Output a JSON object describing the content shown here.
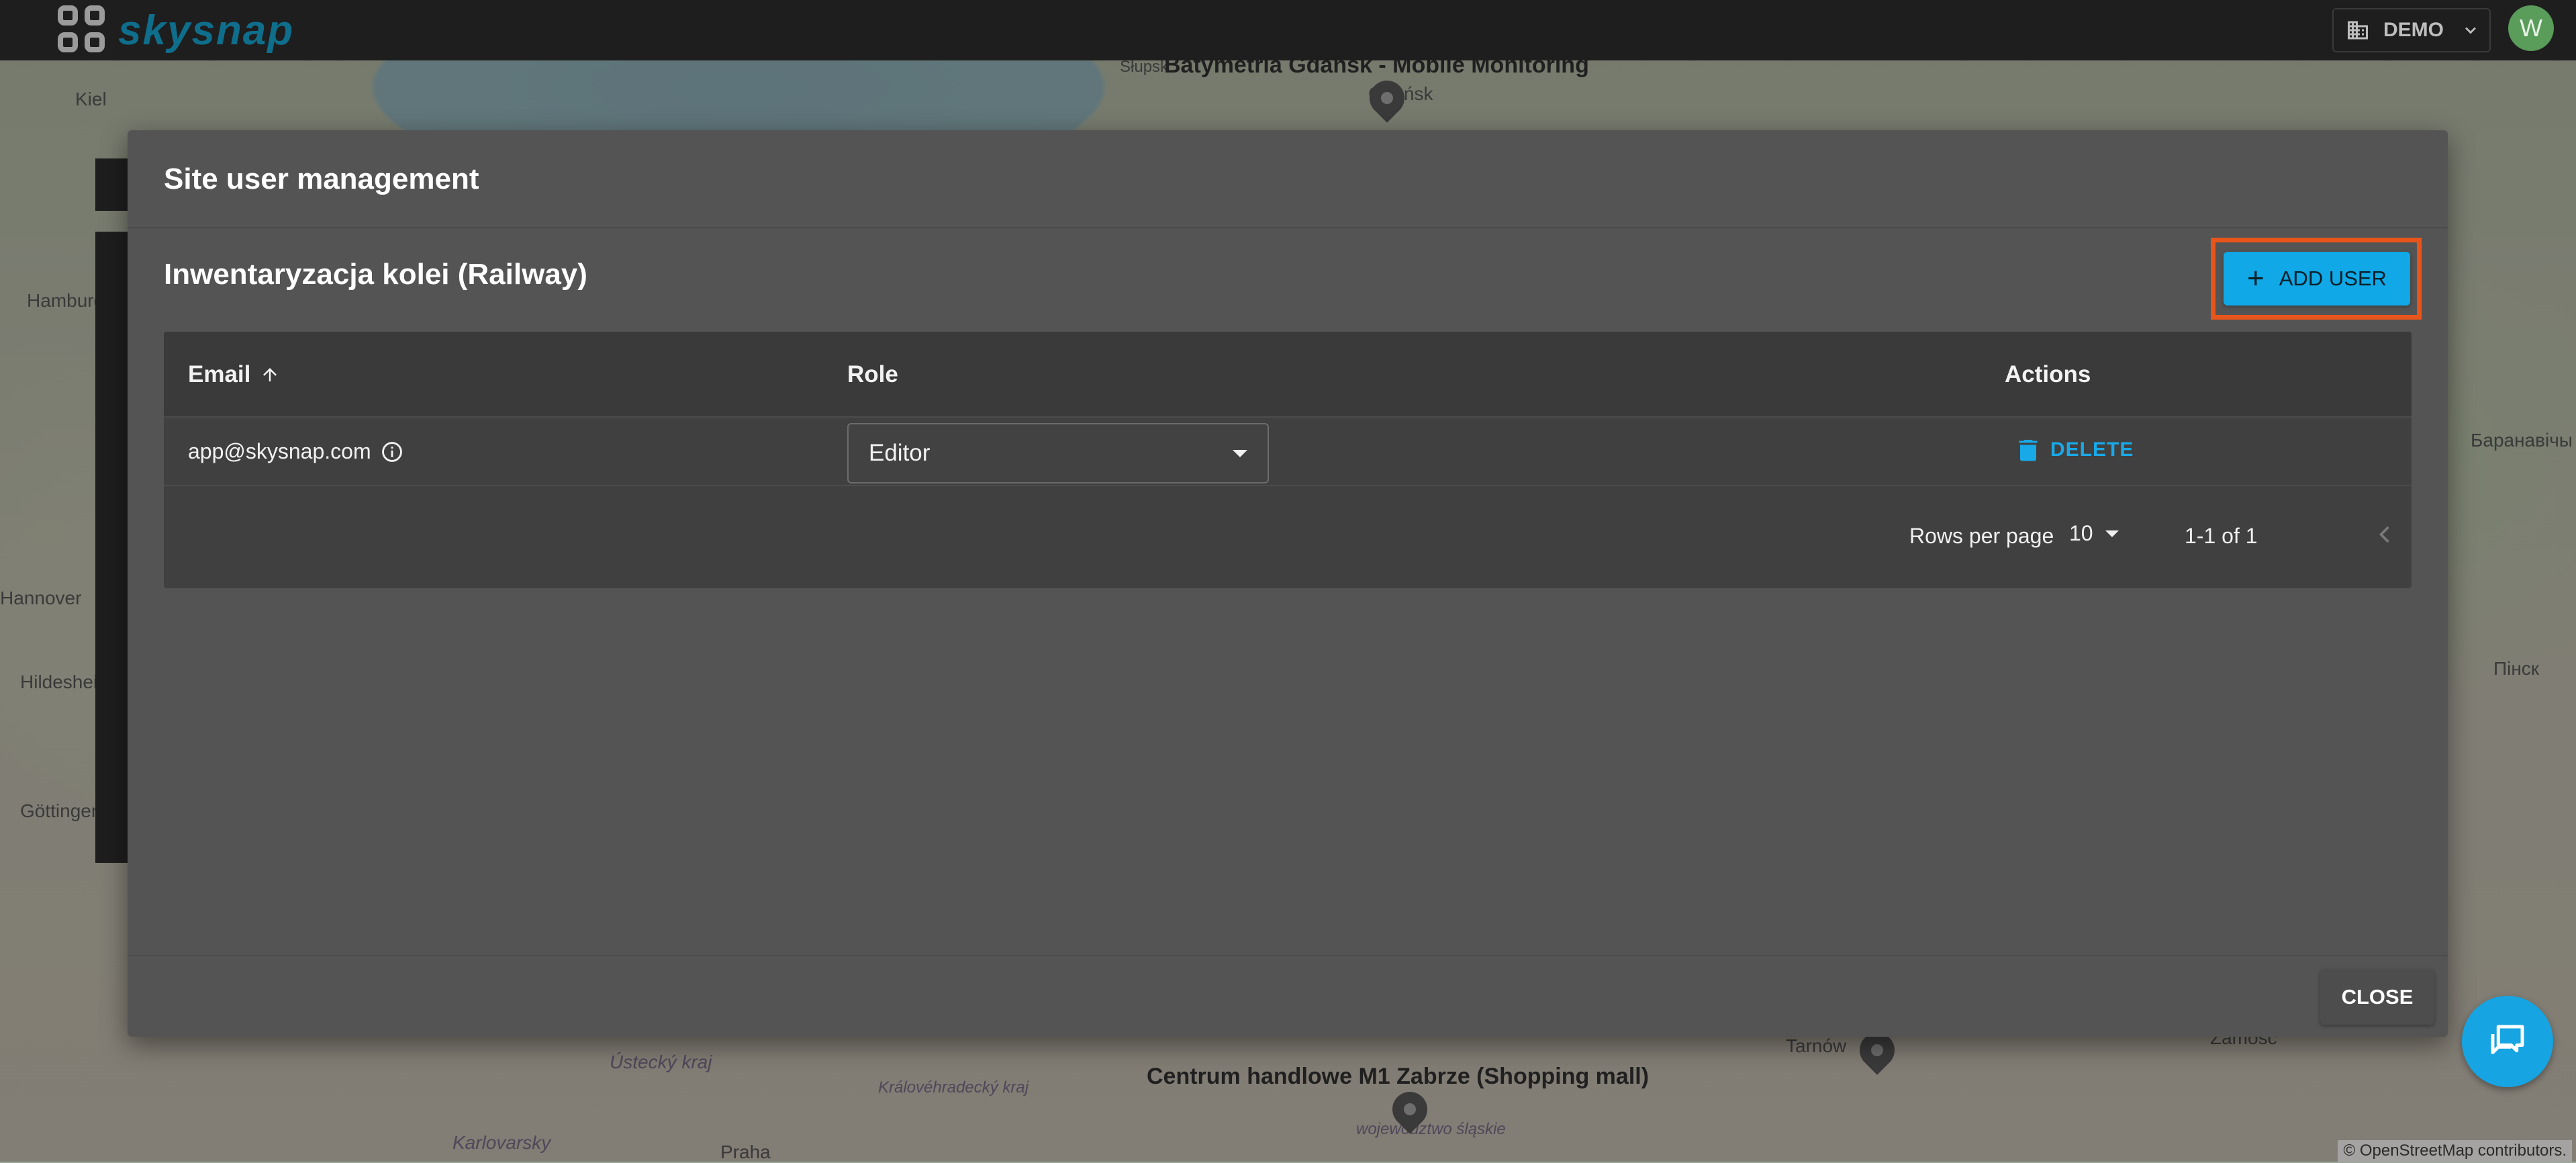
{
  "app": {
    "logo_text": "skysnap"
  },
  "topbar": {
    "org": "DEMO",
    "avatar_initial": "W"
  },
  "map": {
    "cities": [
      "Kiel",
      "Hamburg",
      "Hannover",
      "Hildesheim",
      "Göttingen",
      "Słupsk",
      "Gdańsk",
      "Praha",
      "Karlovarsky",
      "Ústecký kraj",
      "Královéhradecký kraj",
      "województwo śląskie",
      "Tarnów",
      "Zamość",
      "Баранавічы",
      "Пінск"
    ],
    "sites": [
      "Batymetria Gdańsk - Mobile Monitoring",
      "Centrum handlowe M1 Zabrze (Shopping mall)"
    ],
    "attribution": "© OpenStreetMap contributors."
  },
  "dialog": {
    "title": "Site user management",
    "site_name": "Inwentaryzacja kolei (Railway)",
    "add_user_label": "ADD USER",
    "table": {
      "columns": {
        "email": "Email",
        "role": "Role",
        "actions": "Actions"
      },
      "rows": [
        {
          "email": "app@skysnap.com",
          "role": "Editor",
          "action": "DELETE"
        }
      ],
      "pagination": {
        "rows_per_page_label": "Rows per page",
        "rows_per_page": "10",
        "range": "1-1 of 1"
      }
    },
    "close_label": "CLOSE"
  },
  "colors": {
    "accent": "#10a8e6",
    "highlight": "#e8551b",
    "topbar": "#1e1e1e",
    "dialog": "#545454"
  }
}
